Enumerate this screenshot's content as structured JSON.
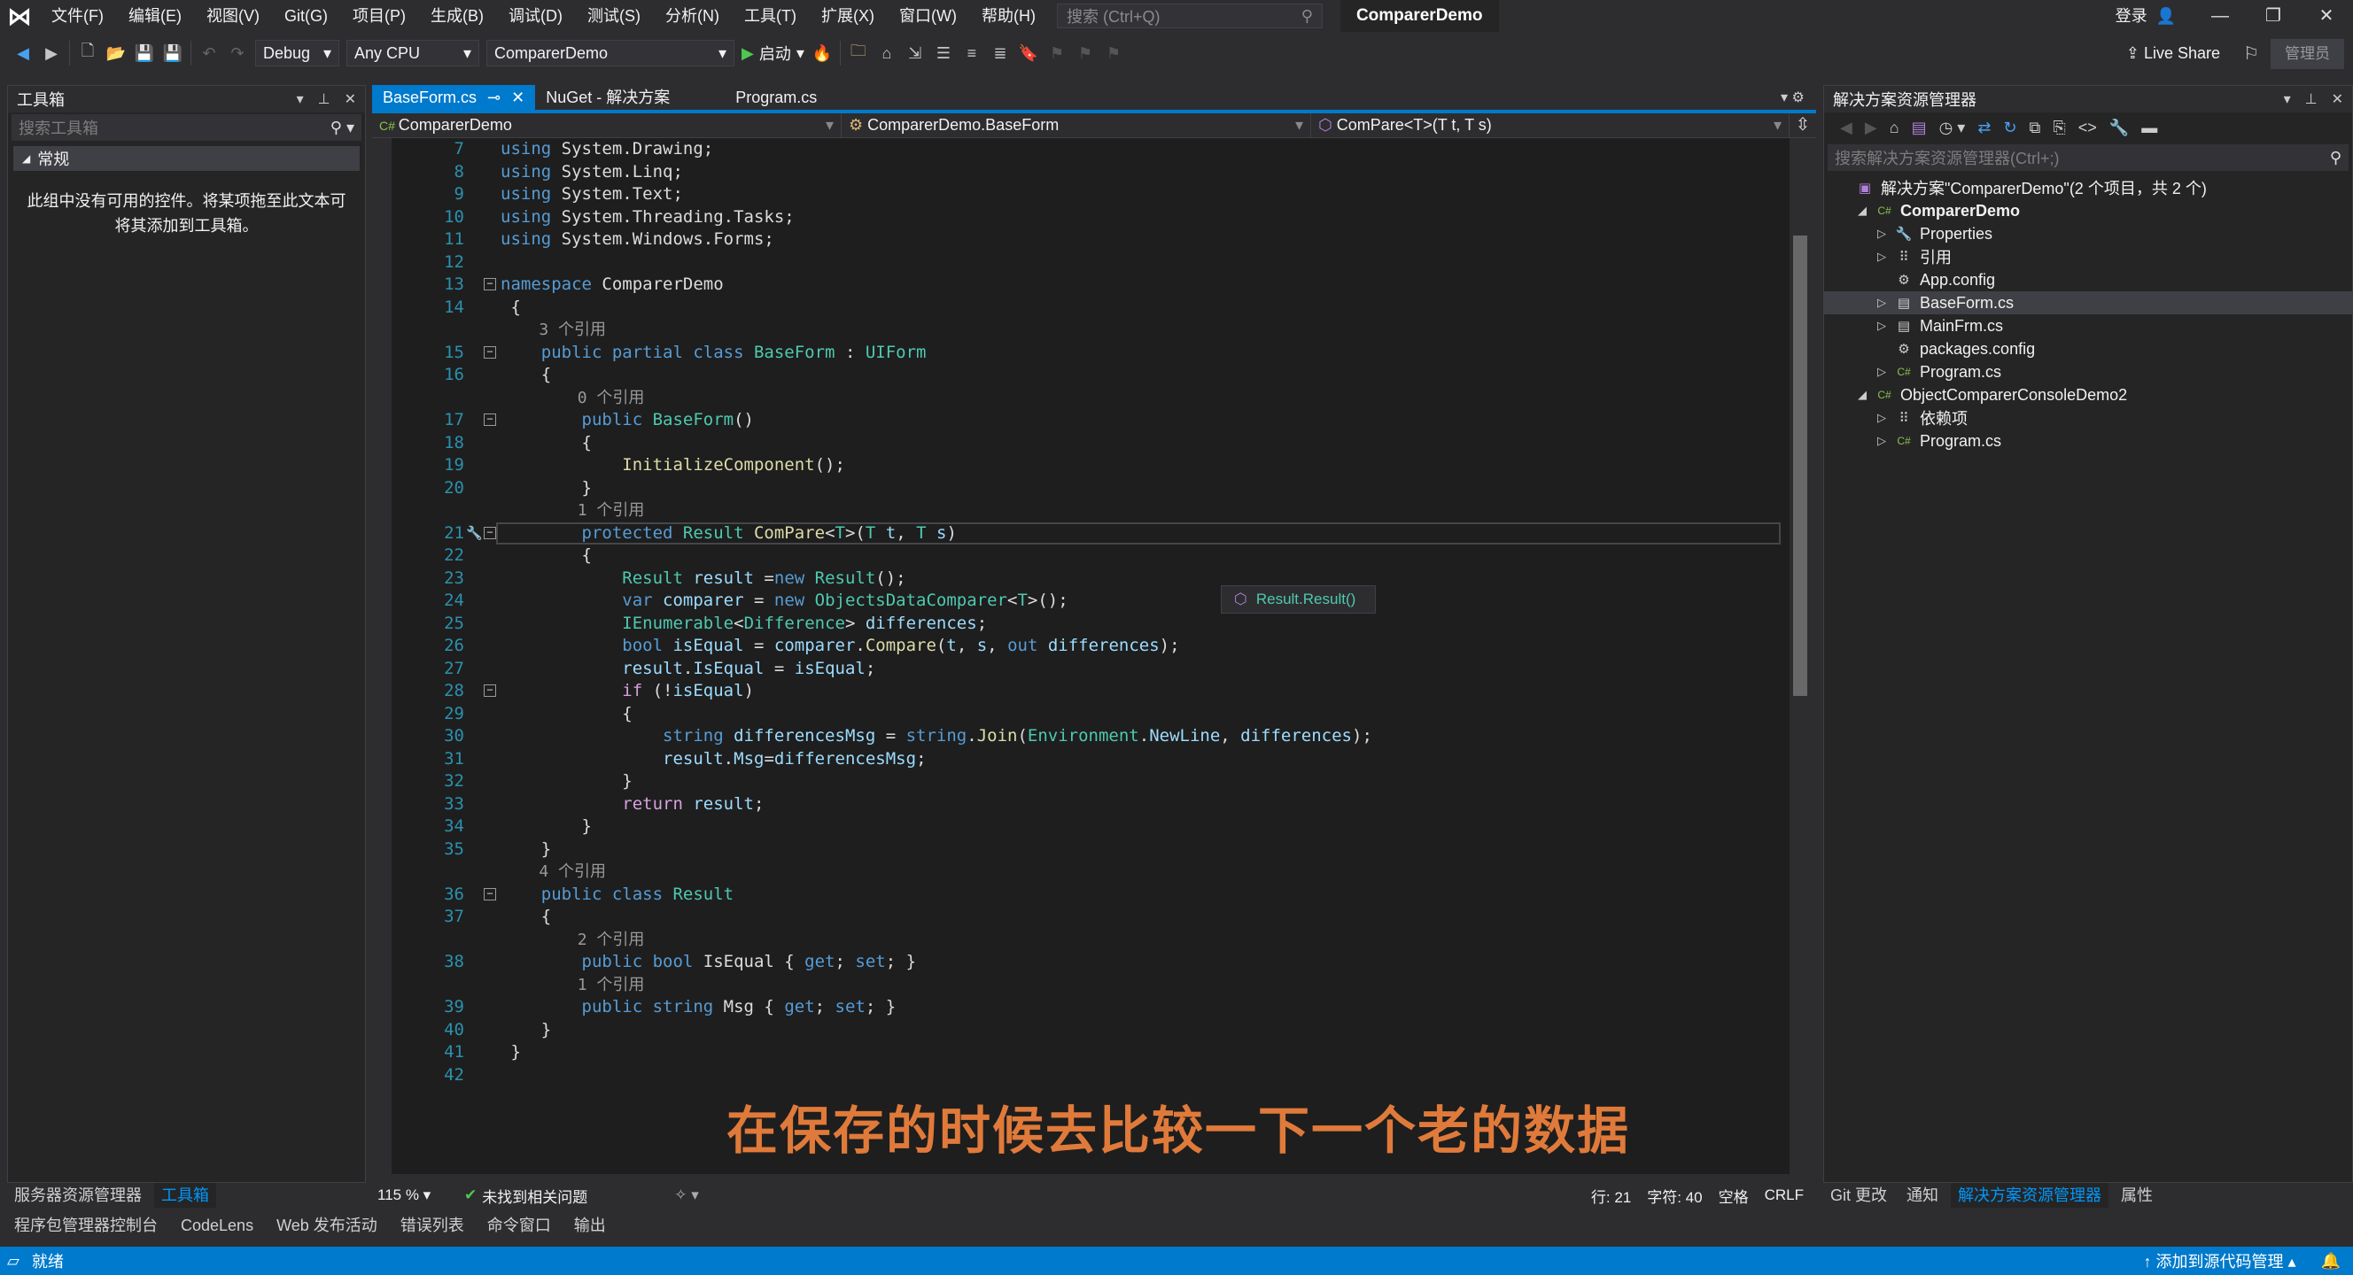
{
  "menubar": {
    "items": [
      "文件(F)",
      "编辑(E)",
      "视图(V)",
      "Git(G)",
      "项目(P)",
      "生成(B)",
      "调试(D)",
      "测试(S)",
      "分析(N)",
      "工具(T)",
      "扩展(X)",
      "窗口(W)",
      "帮助(H)"
    ],
    "search_placeholder": "搜索 (Ctrl+Q)",
    "solution_title": "ComparerDemo",
    "login": "登录"
  },
  "toolbar": {
    "configuration": "Debug",
    "platform": "Any CPU",
    "startup_project": "ComparerDemo",
    "start_label": "启动",
    "live_share": "Live Share",
    "admin": "管理员"
  },
  "toolbox": {
    "title": "工具箱",
    "search_placeholder": "搜索工具箱",
    "group": "常规",
    "empty_message": "此组中没有可用的控件。将某项拖至此文本可将其添加到工具箱。"
  },
  "editor": {
    "tabs": [
      {
        "label": "BaseForm.cs",
        "active": true
      },
      {
        "label": "NuGet - 解决方案",
        "active": false
      },
      {
        "label": "Program.cs",
        "active": false
      }
    ],
    "nav": {
      "project": "ComparerDemo",
      "type": "ComparerDemo.BaseForm",
      "member": "ComPare<T>(T t, T s)"
    },
    "lines": [
      {
        "n": "7",
        "code": [
          [
            "kw",
            "using "
          ],
          [
            "pl",
            "System.Drawing;"
          ]
        ]
      },
      {
        "n": "8",
        "code": [
          [
            "kw",
            "using "
          ],
          [
            "pl",
            "System.Linq;"
          ]
        ]
      },
      {
        "n": "9",
        "code": [
          [
            "kw",
            "using "
          ],
          [
            "pl",
            "System.Text;"
          ]
        ]
      },
      {
        "n": "10",
        "code": [
          [
            "kw",
            "using "
          ],
          [
            "pl",
            "System.Threading.Tasks;"
          ]
        ]
      },
      {
        "n": "11",
        "code": [
          [
            "kw",
            "using "
          ],
          [
            "pl",
            "System.Windows.Forms;"
          ]
        ]
      },
      {
        "n": "12",
        "code": []
      },
      {
        "n": "13",
        "code": [
          [
            "kw",
            "namespace "
          ],
          [
            "pl",
            "ComparerDemo"
          ]
        ]
      },
      {
        "n": "14",
        "code": [
          [
            "pl",
            " {"
          ]
        ]
      },
      {
        "lens": "    3 个引用"
      },
      {
        "n": "15",
        "code": [
          [
            "kw",
            "    public partial class "
          ],
          [
            "ty",
            "BaseForm"
          ],
          [
            "pl",
            " : "
          ],
          [
            "ty",
            "UIForm"
          ]
        ]
      },
      {
        "n": "16",
        "code": [
          [
            "pl",
            "    {"
          ]
        ]
      },
      {
        "lens": "        0 个引用"
      },
      {
        "n": "17",
        "code": [
          [
            "kw",
            "        public "
          ],
          [
            "ty",
            "BaseForm"
          ],
          [
            "pl",
            "()"
          ]
        ]
      },
      {
        "n": "18",
        "code": [
          [
            "pl",
            "        {"
          ]
        ]
      },
      {
        "n": "19",
        "code": [
          [
            "fn",
            "            InitializeComponent"
          ],
          [
            "pl",
            "();"
          ]
        ]
      },
      {
        "n": "20",
        "code": [
          [
            "pl",
            "        }"
          ]
        ]
      },
      {
        "lens": "        1 个引用"
      },
      {
        "n": "21",
        "code": [
          [
            "kw",
            "        protected "
          ],
          [
            "ty",
            "Result "
          ],
          [
            "fn",
            "ComPare"
          ],
          [
            "pl",
            "<"
          ],
          [
            "ty",
            "T"
          ],
          [
            "pl",
            ">("
          ],
          [
            "ty",
            "T "
          ],
          [
            "var",
            "t"
          ],
          [
            "pl",
            ", "
          ],
          [
            "ty",
            "T "
          ],
          [
            "var",
            "s"
          ],
          [
            "pl",
            ")"
          ]
        ]
      },
      {
        "n": "22",
        "code": [
          [
            "pl",
            "        {"
          ]
        ]
      },
      {
        "n": "23",
        "code": [
          [
            "ty",
            "            Result "
          ],
          [
            "var",
            "result "
          ],
          [
            "pl",
            "="
          ],
          [
            "kw",
            "new "
          ],
          [
            "ty",
            "Result"
          ],
          [
            "pl",
            "();"
          ]
        ]
      },
      {
        "n": "24",
        "code": [
          [
            "kw",
            "            var "
          ],
          [
            "var",
            "comparer "
          ],
          [
            "pl",
            "= "
          ],
          [
            "kw",
            "new "
          ],
          [
            "ty",
            "ObjectsDataComparer"
          ],
          [
            "pl",
            "<"
          ],
          [
            "ty",
            "T"
          ],
          [
            "pl",
            ">();"
          ]
        ]
      },
      {
        "n": "25",
        "code": [
          [
            "ty",
            "            IEnumerable"
          ],
          [
            "pl",
            "<"
          ],
          [
            "ty",
            "Difference"
          ],
          [
            "pl",
            "> "
          ],
          [
            "var",
            "differences"
          ],
          [
            "pl",
            ";"
          ]
        ]
      },
      {
        "n": "26",
        "code": [
          [
            "kw",
            "            bool "
          ],
          [
            "var",
            "isEqual "
          ],
          [
            "pl",
            "= "
          ],
          [
            "var",
            "comparer"
          ],
          [
            "pl",
            "."
          ],
          [
            "fn",
            "Compare"
          ],
          [
            "pl",
            "("
          ],
          [
            "var",
            "t"
          ],
          [
            "pl",
            ", "
          ],
          [
            "var",
            "s"
          ],
          [
            "pl",
            ", "
          ],
          [
            "kw",
            "out "
          ],
          [
            "var",
            "differences"
          ],
          [
            "pl",
            ");"
          ]
        ]
      },
      {
        "n": "27",
        "code": [
          [
            "var",
            "            result"
          ],
          [
            "pl",
            "."
          ],
          [
            "var",
            "IsEqual "
          ],
          [
            "pl",
            "= "
          ],
          [
            "var",
            "isEqual"
          ],
          [
            "pl",
            ";"
          ]
        ]
      },
      {
        "n": "28",
        "code": [
          [
            "ctl-kw",
            "            if "
          ],
          [
            "pl",
            "(!"
          ],
          [
            "var",
            "isEqual"
          ],
          [
            "pl",
            ")"
          ]
        ]
      },
      {
        "n": "29",
        "code": [
          [
            "pl",
            "            {"
          ]
        ]
      },
      {
        "n": "30",
        "code": [
          [
            "kw",
            "                string "
          ],
          [
            "var",
            "differencesMsg "
          ],
          [
            "pl",
            "= "
          ],
          [
            "kw",
            "string"
          ],
          [
            "pl",
            "."
          ],
          [
            "fn",
            "Join"
          ],
          [
            "pl",
            "("
          ],
          [
            "ty",
            "Environment"
          ],
          [
            "pl",
            "."
          ],
          [
            "var",
            "NewLine"
          ],
          [
            "pl",
            ", "
          ],
          [
            "var",
            "differences"
          ],
          [
            "pl",
            ");"
          ]
        ]
      },
      {
        "n": "31",
        "code": [
          [
            "var",
            "                result"
          ],
          [
            "pl",
            "."
          ],
          [
            "var",
            "Msg"
          ],
          [
            "pl",
            "="
          ],
          [
            "var",
            "differencesMsg"
          ],
          [
            "pl",
            ";"
          ]
        ]
      },
      {
        "n": "32",
        "code": [
          [
            "pl",
            "            }"
          ]
        ]
      },
      {
        "n": "33",
        "code": [
          [
            "ctl-kw",
            "            return "
          ],
          [
            "var",
            "result"
          ],
          [
            "pl",
            ";"
          ]
        ]
      },
      {
        "n": "34",
        "code": [
          [
            "pl",
            "        }"
          ]
        ]
      },
      {
        "n": "35",
        "code": [
          [
            "pl",
            "    }"
          ]
        ]
      },
      {
        "lens": "    4 个引用"
      },
      {
        "n": "36",
        "code": [
          [
            "kw",
            "    public class "
          ],
          [
            "ty",
            "Result"
          ]
        ]
      },
      {
        "n": "37",
        "code": [
          [
            "pl",
            "    {"
          ]
        ]
      },
      {
        "lens": "        2 个引用"
      },
      {
        "n": "38",
        "code": [
          [
            "kw",
            "        public bool "
          ],
          [
            "pl",
            "IsEqual { "
          ],
          [
            "kw",
            "get"
          ],
          [
            "pl",
            "; "
          ],
          [
            "kw",
            "set"
          ],
          [
            "pl",
            "; }"
          ]
        ]
      },
      {
        "lens": "        1 个引用"
      },
      {
        "n": "39",
        "code": [
          [
            "kw",
            "        public string "
          ],
          [
            "pl",
            "Msg { "
          ],
          [
            "kw",
            "get"
          ],
          [
            "pl",
            "; "
          ],
          [
            "kw",
            "set"
          ],
          [
            "pl",
            "; }"
          ]
        ]
      },
      {
        "n": "40",
        "code": [
          [
            "pl",
            "    }"
          ]
        ]
      },
      {
        "n": "41",
        "code": [
          [
            "pl",
            " }"
          ]
        ]
      },
      {
        "n": "42",
        "code": []
      }
    ],
    "quick_info": "Result.Result()",
    "subtitle": "在保存的时候去比较一下一个老的数据",
    "status": {
      "zoom": "115 %",
      "issues": "未找到相关问题",
      "line": "行: 21",
      "char": "字符: 40",
      "spaces": "空格",
      "eol": "CRLF"
    }
  },
  "solution_explorer": {
    "title": "解决方案资源管理器",
    "search_placeholder": "搜索解决方案资源管理器(Ctrl+;)",
    "items": [
      {
        "label": "解决方案\"ComparerDemo\"(2 个项目，共 2 个)",
        "indent": 0,
        "arrow": "",
        "icon": "solution-icon"
      },
      {
        "label": "ComparerDemo",
        "indent": 1,
        "arrow": "◢",
        "icon": "csharp-project-icon",
        "bold": true
      },
      {
        "label": "Properties",
        "indent": 2,
        "arrow": "▷",
        "icon": "wrench-icon"
      },
      {
        "label": "引用",
        "indent": 2,
        "arrow": "▷",
        "icon": "references-icon"
      },
      {
        "label": "App.config",
        "indent": 2,
        "arrow": "",
        "icon": "config-file-icon"
      },
      {
        "label": "BaseForm.cs",
        "indent": 2,
        "arrow": "▷",
        "icon": "form-icon",
        "selected": true
      },
      {
        "label": "MainFrm.cs",
        "indent": 2,
        "arrow": "▷",
        "icon": "form-icon"
      },
      {
        "label": "packages.config",
        "indent": 2,
        "arrow": "",
        "icon": "config-file-icon"
      },
      {
        "label": "Program.cs",
        "indent": 2,
        "arrow": "▷",
        "icon": "csharp-file-icon"
      },
      {
        "label": "ObjectComparerConsoleDemo2",
        "indent": 1,
        "arrow": "◢",
        "icon": "csharp-project-icon"
      },
      {
        "label": "依赖项",
        "indent": 2,
        "arrow": "▷",
        "icon": "references-icon"
      },
      {
        "label": "Program.cs",
        "indent": 2,
        "arrow": "▷",
        "icon": "csharp-file-icon"
      }
    ]
  },
  "bottom_tabs_left": [
    {
      "label": "服务器资源管理器",
      "active": false
    },
    {
      "label": "工具箱",
      "active": true
    }
  ],
  "bottom_tabs_right": [
    {
      "label": "Git 更改",
      "active": false
    },
    {
      "label": "通知",
      "active": false
    },
    {
      "label": "解决方案资源管理器",
      "active": true
    },
    {
      "label": "属性",
      "active": false
    }
  ],
  "tool_windows": [
    "程序包管理器控制台",
    "CodeLens",
    "Web 发布活动",
    "错误列表",
    "命令窗口",
    "输出"
  ],
  "statusbar": {
    "ready": "就绪",
    "source_control": "添加到源代码管理"
  },
  "colors": {
    "accent": "#007acc",
    "subtitle": "#e07a3a",
    "keyword": "#569cd6",
    "type": "#4ec9b0",
    "method": "#dcdcaa",
    "line_number": "#2b91af"
  }
}
